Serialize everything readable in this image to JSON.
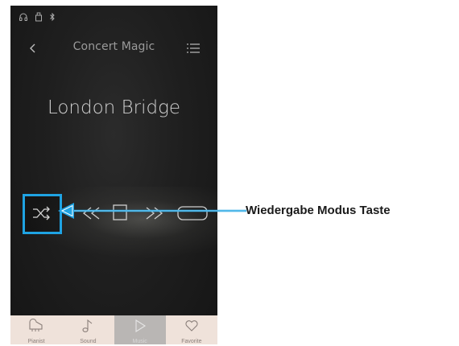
{
  "status_bar": {
    "icons": [
      "headphones-icon",
      "usb-icon",
      "bluetooth-icon"
    ]
  },
  "nav": {
    "back_icon": "chevron-left-icon",
    "title": "Concert Magic",
    "list_icon": "list-icon"
  },
  "song": {
    "title": "London Bridge"
  },
  "controls": {
    "items": [
      "shuffle-icon",
      "rewind-icon",
      "stop-icon",
      "fast-forward-icon",
      "loop-icon"
    ]
  },
  "tabs": [
    {
      "label": "Pianist",
      "icon": "piano-icon",
      "active": false
    },
    {
      "label": "Sound",
      "icon": "music-note-icon",
      "active": false
    },
    {
      "label": "Music",
      "icon": "play-icon",
      "active": true
    },
    {
      "label": "Favorite",
      "icon": "heart-icon",
      "active": false
    }
  ],
  "annotation": {
    "label": "Wiedergabe Modus Taste"
  },
  "colors": {
    "highlight": "#1fa3e3",
    "tab_bar": "#efe2da",
    "tab_active": "#b9b6b4",
    "background_dark": "#1a1a1a"
  }
}
